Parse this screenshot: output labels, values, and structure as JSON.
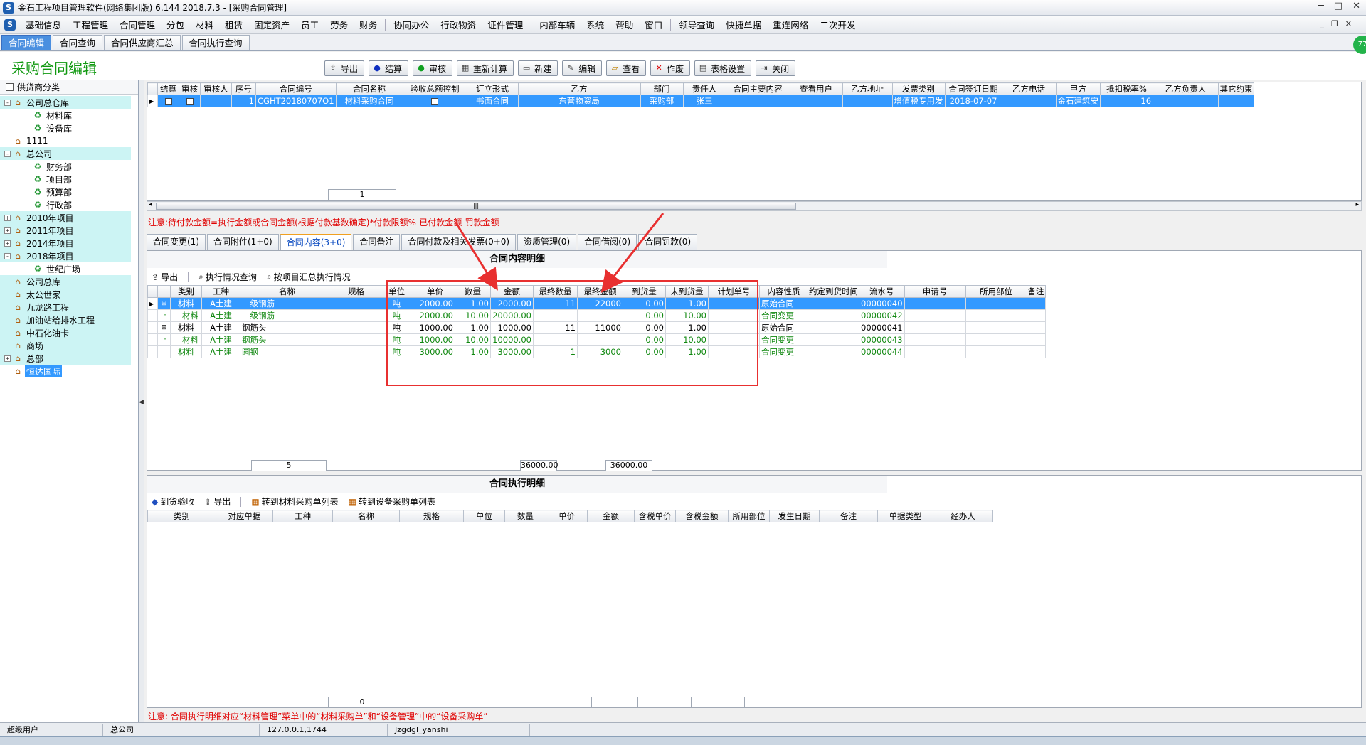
{
  "window": {
    "title": "金石工程项目管理软件(网络集团版) 6.144  2018.7.3 - [采购合同管理]"
  },
  "menu": [
    "基础信息",
    "工程管理",
    "合同管理",
    "分包",
    "材料",
    "租赁",
    "固定资产",
    "员工",
    "劳务",
    "财务",
    "协同办公",
    "行政物资",
    "证件管理",
    "内部车辆",
    "系统",
    "帮助",
    "窗口",
    "领导查询",
    "快捷单据",
    "重连网络",
    "二次开发"
  ],
  "subtabs": [
    "合同编辑",
    "合同查询",
    "合同供应商汇总",
    "合同执行查询"
  ],
  "page": {
    "title": "采购合同编辑"
  },
  "toolbar": [
    "导出",
    "结算",
    "审核",
    "重新计算",
    "新建",
    "编辑",
    "查看",
    "作废",
    "表格设置",
    "关闭"
  ],
  "sidebar": {
    "header": "供货商分类",
    "nodes": [
      {
        "label": "公司总仓库",
        "level": 0,
        "exp": "-",
        "hl": true
      },
      {
        "label": "材料库",
        "level": 1
      },
      {
        "label": "设备库",
        "level": 1
      },
      {
        "label": "1111",
        "level": 0
      },
      {
        "label": "总公司",
        "level": 0,
        "exp": "-",
        "hl": true
      },
      {
        "label": "财务部",
        "level": 1
      },
      {
        "label": "项目部",
        "level": 1
      },
      {
        "label": "预算部",
        "level": 1
      },
      {
        "label": "行政部",
        "level": 1
      },
      {
        "label": "2010年项目",
        "level": 0,
        "exp": "+",
        "hl": true
      },
      {
        "label": "2011年项目",
        "level": 0,
        "exp": "+",
        "hl": true
      },
      {
        "label": "2014年项目",
        "level": 0,
        "exp": "+",
        "hl": true
      },
      {
        "label": "2018年项目",
        "level": 0,
        "exp": "-",
        "hl": true
      },
      {
        "label": "世纪广场",
        "level": 1
      },
      {
        "label": "公司总库",
        "level": 0,
        "hl": true
      },
      {
        "label": "太公世家",
        "level": 0,
        "hl": true
      },
      {
        "label": "九龙路工程",
        "level": 0,
        "hl": true
      },
      {
        "label": "加油站给排水工程",
        "level": 0,
        "hl": true
      },
      {
        "label": "中石化油卡",
        "level": 0,
        "hl": true
      },
      {
        "label": "商场",
        "level": 0,
        "hl": true
      },
      {
        "label": "总部",
        "level": 0,
        "exp": "+",
        "hl": true
      },
      {
        "label": "恒达国际",
        "level": 0,
        "sel": true
      }
    ]
  },
  "grid1": {
    "columns": [
      "结算",
      "审核",
      "审核人",
      "序号",
      "合同编号",
      "合同名称",
      "验收总额控制",
      "订立形式",
      "乙方",
      "部门",
      "责任人",
      "合同主要内容",
      "查看用户",
      "乙方地址",
      "发票类别",
      "合同签订日期",
      "乙方电话",
      "甲方",
      "抵扣税率%",
      "乙方负责人",
      "其它约束"
    ],
    "row": {
      "seq": "1",
      "code": "CGHT20180707O1",
      "name": "材料采购合同",
      "form": "书面合同",
      "party_b": "东营物资局",
      "dept": "采购部",
      "owner": "张三",
      "invoice": "增值税专用发",
      "date": "2018-07-07",
      "party_a": "金石建筑安",
      "tax": "16"
    },
    "count": "1"
  },
  "note1": "注意:待付款金额=执行金额或合同金额(根据付款基数确定)*付款限额%-已付款金额-罚款金额",
  "tabs2": [
    "合同变更(1)",
    "合同附件(1+0)",
    "合同内容(3+0)",
    "合同备注",
    "合同付款及相关发票(0+0)",
    "资质管理(0)",
    "合同借阅(0)",
    "合同罚款(0)"
  ],
  "content": {
    "title": "合同内容明细",
    "tools": [
      "导出",
      "执行情况查询",
      "按项目汇总执行情况"
    ],
    "columns": [
      "类别",
      "工种",
      "名称",
      "规格",
      "单位",
      "单价",
      "数量",
      "金额",
      "最终数量",
      "最终金额",
      "到货量",
      "未到货量",
      "计划单号",
      "内容性质",
      "约定到货时间",
      "流水号",
      "申请号",
      "所用部位",
      "备注"
    ],
    "rows": [
      {
        "cat": "材料",
        "work": "A土建",
        "name": "二级钢筋",
        "unit": "吨",
        "price": "2000.00",
        "qty": "1.00",
        "amount": "2000.00",
        "fqty": "11",
        "famount": "22000",
        "arrived": "0.00",
        "pending": "1.00",
        "nature": "原始合同",
        "serial": "00000040",
        "sel": true,
        "exp": "-"
      },
      {
        "cat": "材料",
        "work": "A土建",
        "name": "二级钢筋",
        "unit": "吨",
        "price": "2000.00",
        "qty": "10.00",
        "amount": "20000.00",
        "fqty": "",
        "famount": "",
        "arrived": "0.00",
        "pending": "10.00",
        "nature": "合同变更",
        "serial": "00000042",
        "green": true,
        "child": true
      },
      {
        "cat": "材料",
        "work": "A土建",
        "name": "钢筋头",
        "unit": "吨",
        "price": "1000.00",
        "qty": "1.00",
        "amount": "1000.00",
        "fqty": "11",
        "famount": "11000",
        "arrived": "0.00",
        "pending": "1.00",
        "nature": "原始合同",
        "serial": "00000041",
        "exp": "-"
      },
      {
        "cat": "材料",
        "work": "A土建",
        "name": "钢筋头",
        "unit": "吨",
        "price": "1000.00",
        "qty": "10.00",
        "amount": "10000.00",
        "fqty": "",
        "famount": "",
        "arrived": "0.00",
        "pending": "10.00",
        "nature": "合同变更",
        "serial": "00000043",
        "green": true,
        "child": true
      },
      {
        "cat": "材料",
        "work": "A土建",
        "name": "圆钢",
        "unit": "吨",
        "price": "3000.00",
        "qty": "1.00",
        "amount": "3000.00",
        "fqty": "1",
        "famount": "3000",
        "arrived": "0.00",
        "pending": "1.00",
        "nature": "合同变更",
        "serial": "00000044",
        "green": true
      }
    ],
    "footer": {
      "count": "5",
      "amount": "36000.00",
      "famount": "36000.00"
    }
  },
  "exec": {
    "title": "合同执行明细",
    "tools": [
      "到货验收",
      "导出",
      "转到材料采购单列表",
      "转到设备采购单列表"
    ],
    "columns": [
      "类别",
      "对应单据",
      "工种",
      "名称",
      "规格",
      "单位",
      "数量",
      "单价",
      "金额",
      "含税单价",
      "含税金额",
      "所用部位",
      "发生日期",
      "备注",
      "单据类型",
      "经办人"
    ],
    "count": "0"
  },
  "note2": "注意: 合同执行明细对应“材料管理”菜单中的“材料采购单”和“设备管理”中的“设备采购单”",
  "status": [
    "超级用户",
    "总公司",
    "127.0.0.1,1744",
    "Jzgdgl_yanshi"
  ],
  "badge": "77"
}
